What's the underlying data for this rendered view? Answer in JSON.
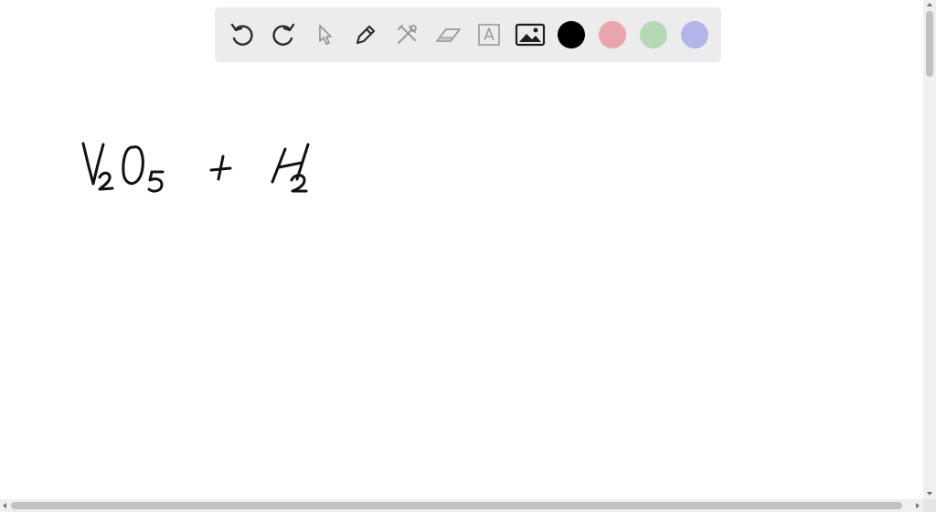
{
  "toolbar": {
    "tools": [
      {
        "name": "undo-icon"
      },
      {
        "name": "redo-icon"
      },
      {
        "name": "select-pointer-icon"
      },
      {
        "name": "pen-icon"
      },
      {
        "name": "tools-icon"
      },
      {
        "name": "eraser-icon"
      },
      {
        "name": "text-box-icon"
      },
      {
        "name": "image-icon"
      }
    ],
    "colors": [
      "#000000",
      "#e8a6ac",
      "#b4d9b4",
      "#b4b4ec"
    ],
    "selected_color": "#000000"
  },
  "canvas": {
    "handwritten_text": "V2O5 + H2"
  }
}
